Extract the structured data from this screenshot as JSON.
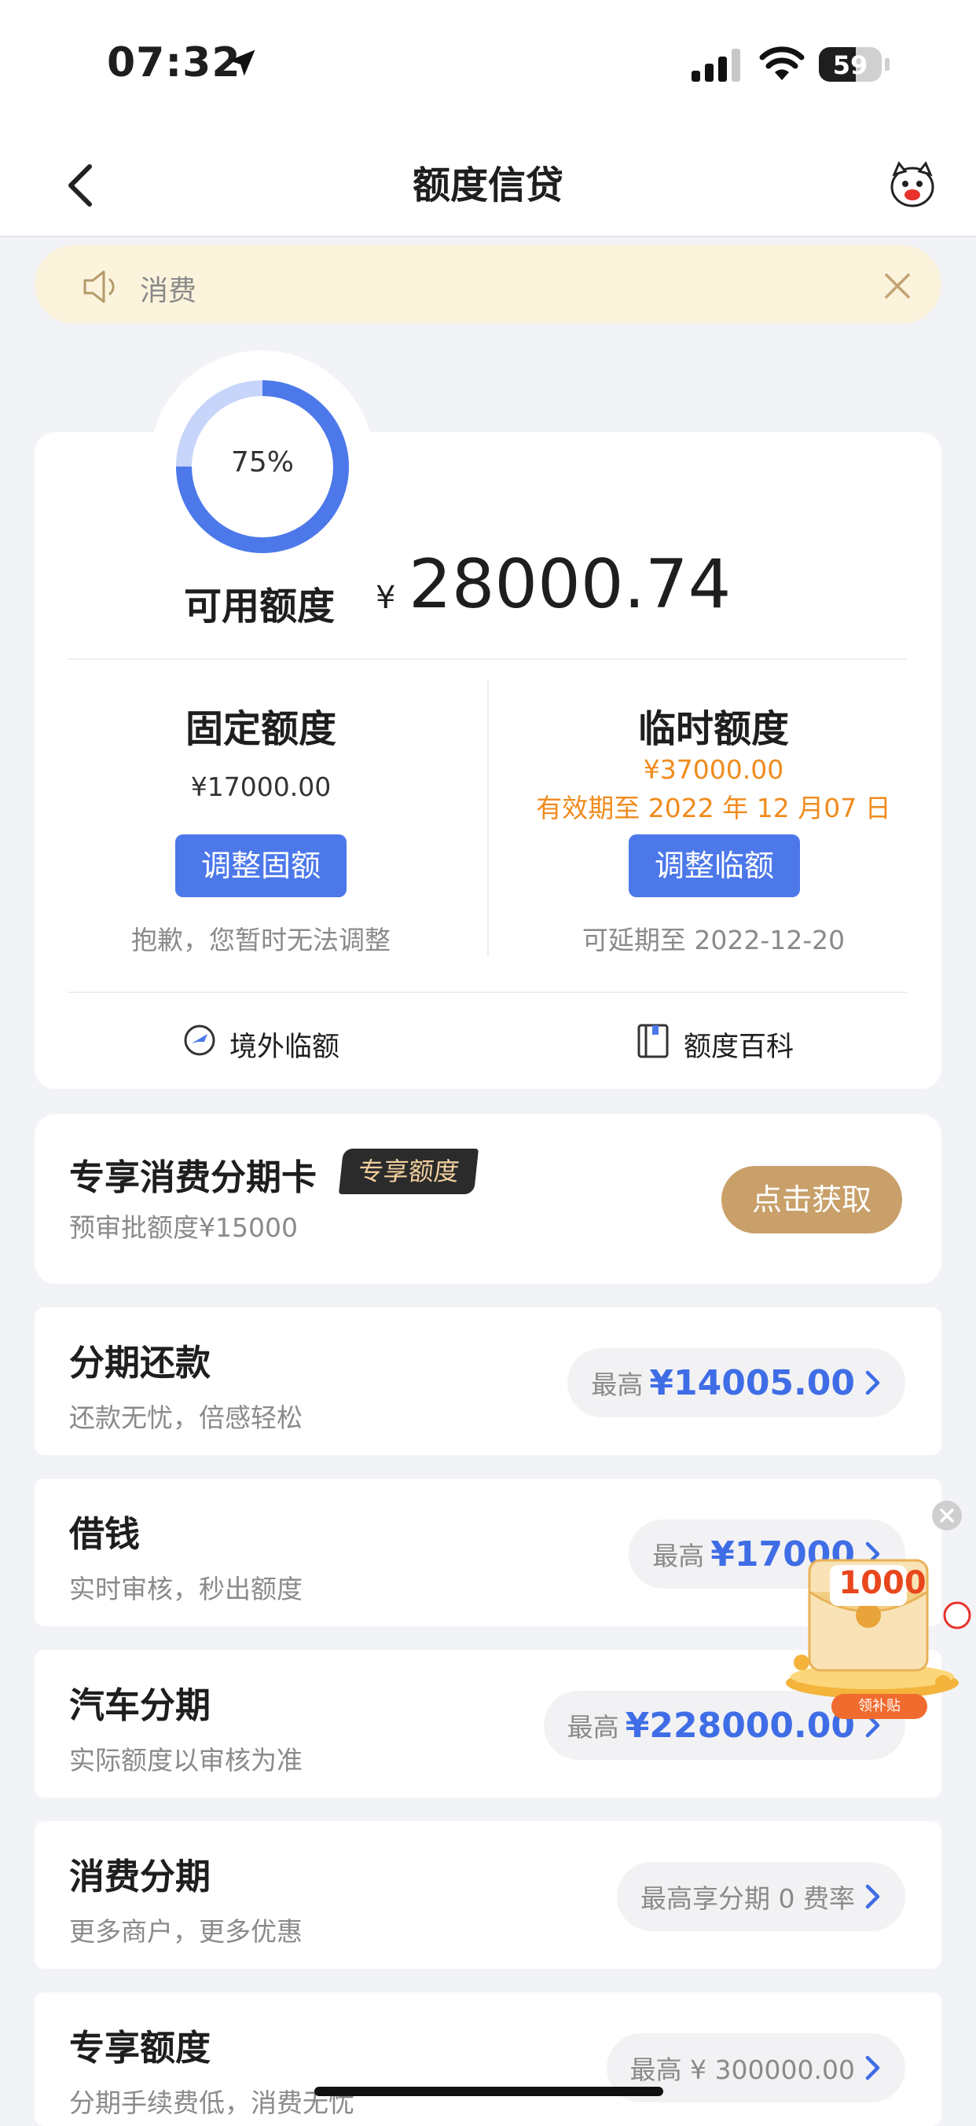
{
  "status_bar": {
    "time": "07:32",
    "battery": "59",
    "battery_level": 0.59
  },
  "nav": {
    "title": "额度信贷"
  },
  "notice": {
    "text": "消费"
  },
  "credit": {
    "ring_percent": 0.75,
    "ring_label": "75%",
    "available_label": "可用额度",
    "currency": "¥",
    "available_amount": "28000.74",
    "fixed": {
      "title": "固定额度",
      "value": "¥17000.00",
      "button": "调整固额",
      "note": "抱歉，您暂时无法调整"
    },
    "temporary": {
      "title": "临时额度",
      "value": "¥37000.00",
      "validity": "有效期至 2022 年 12 月07 日",
      "button": "调整临额",
      "note": "可延期至 2022-12-20"
    },
    "links": {
      "overseas": "境外临额",
      "wiki": "额度百科"
    }
  },
  "exclusive": {
    "title": "专享消费分期卡",
    "badge": "专享额度",
    "subtitle": "预审批额度¥15000",
    "button": "点击获取"
  },
  "rows": [
    {
      "title": "分期还款",
      "subtitle": "还款无忧，倍感轻松",
      "prefix": "最高",
      "amount": "¥14005.00"
    },
    {
      "title": "借钱",
      "subtitle": "实时审核，秒出额度",
      "prefix": "最高",
      "amount": "¥17000"
    },
    {
      "title": "汽车分期",
      "subtitle": "实际额度以审核为准",
      "prefix": "最高",
      "amount": "¥228000.00"
    },
    {
      "title": "消费分期",
      "subtitle": "更多商户，更多优惠",
      "text": "最高享分期 0 费率"
    },
    {
      "title": "专享额度",
      "subtitle": "分期手续费低，消费无忧",
      "text": "最高 ¥ 300000.00"
    }
  ],
  "ad": {
    "number": "1000",
    "tag": "领补贴"
  },
  "colors": {
    "accent": "#4c78ea",
    "orange": "#f08b1d",
    "gold": "#c9a06a"
  }
}
